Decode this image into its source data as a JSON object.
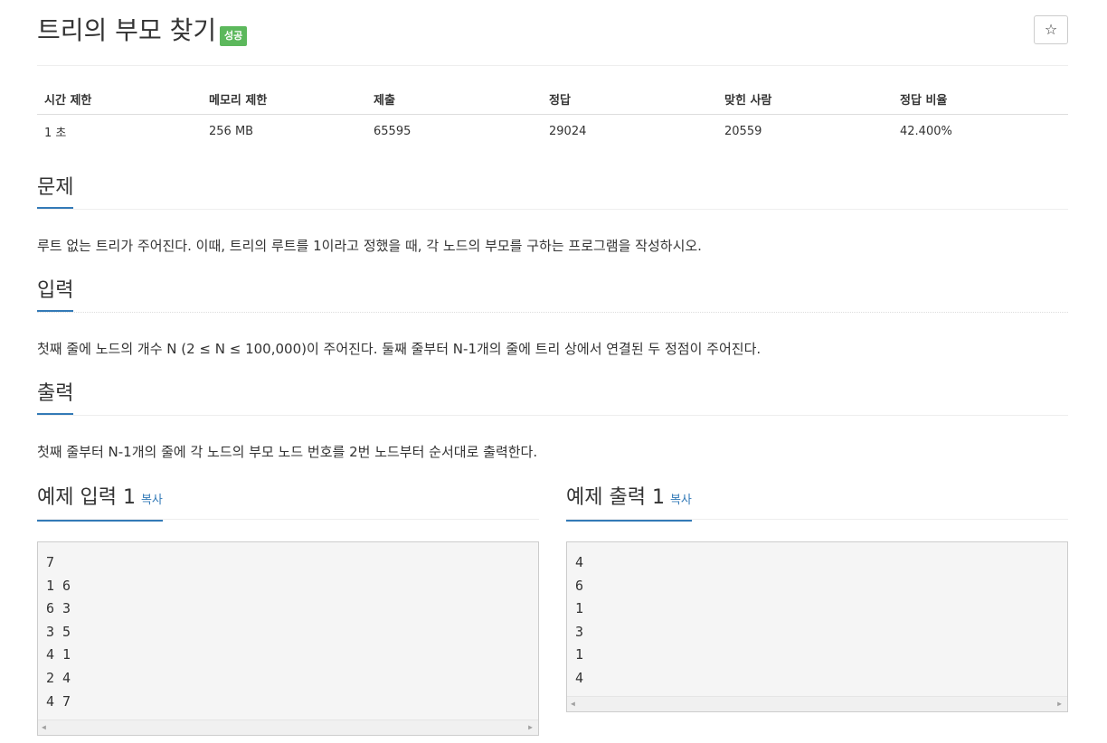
{
  "problem": {
    "title": "트리의 부모 찾기",
    "status_badge": "성공",
    "star_icon": "☆"
  },
  "info_table": {
    "headers": [
      "시간 제한",
      "메모리 제한",
      "제출",
      "정답",
      "맞힌 사람",
      "정답 비율"
    ],
    "values": [
      "1 초",
      "256 MB",
      "65595",
      "29024",
      "20559",
      "42.400%"
    ]
  },
  "sections": {
    "problem": {
      "title": "문제",
      "text": "루트 없는 트리가 주어진다. 이때, 트리의 루트를 1이라고 정했을 때, 각 노드의 부모를 구하는 프로그램을 작성하시오."
    },
    "input": {
      "title": "입력",
      "text": "첫째 줄에 노드의 개수 N (2 ≤ N ≤ 100,000)이 주어진다. 둘째 줄부터 N-1개의 줄에 트리 상에서 연결된 두 정점이 주어진다."
    },
    "output": {
      "title": "출력",
      "text": "첫째 줄부터 N-1개의 줄에 각 노드의 부모 노드 번호를 2번 노드부터 순서대로 출력한다."
    }
  },
  "samples": {
    "input": {
      "title": "예제 입력 1",
      "copy_label": "복사",
      "lines": [
        "7",
        "1 6",
        "6 3",
        "3 5",
        "4 1",
        "2 4",
        "4 7"
      ]
    },
    "output": {
      "title": "예제 출력 1",
      "copy_label": "복사",
      "lines": [
        "4",
        "6",
        "1",
        "3",
        "1",
        "4"
      ]
    }
  },
  "scroll_arrows": {
    "left": "◀",
    "right": "▶"
  }
}
